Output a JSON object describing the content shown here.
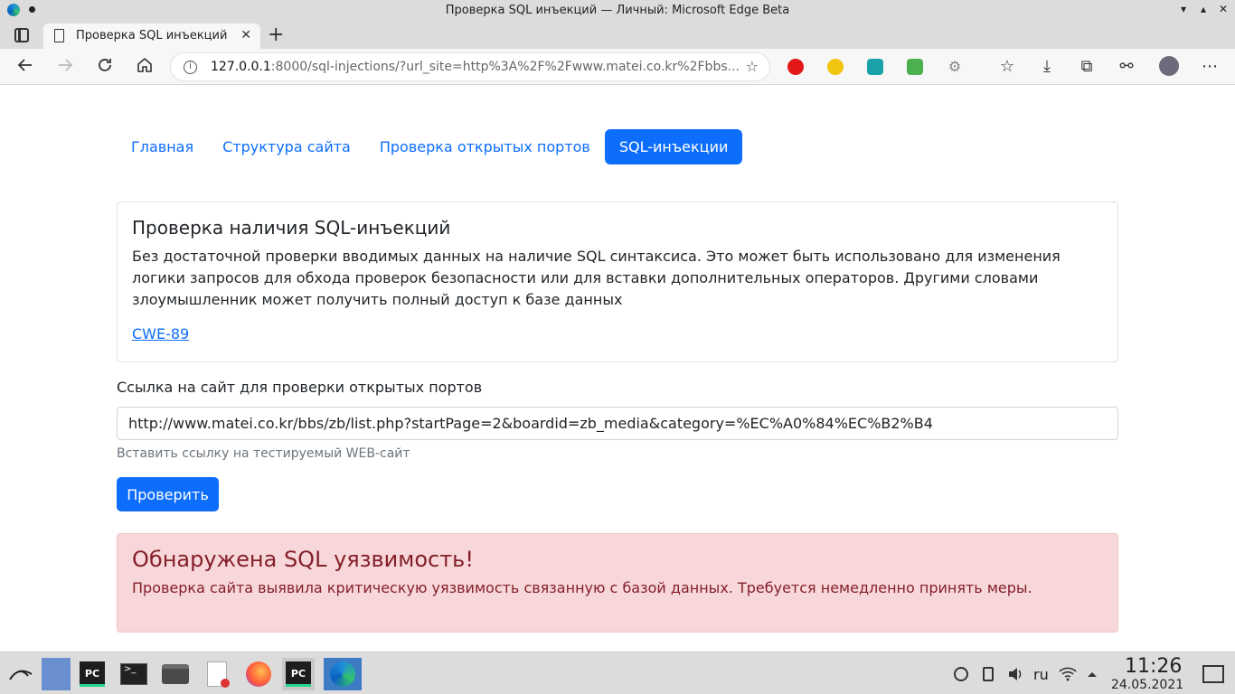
{
  "window": {
    "title": "Проверка SQL инъекций — Личный: Microsoft Edge Beta",
    "minimize": "▾",
    "maximize": "▴",
    "close": "✕"
  },
  "tab": {
    "title": "Проверка SQL инъекций",
    "close": "✕",
    "new_tab": "+"
  },
  "address_bar": {
    "url_host": "127.0.0.1",
    "url_rest": ":8000/sql-injections/?url_site=http%3A%2F%2Fwww.matei.co.kr%2Fbbs..."
  },
  "nav": {
    "items": [
      {
        "label": "Главная",
        "active": false
      },
      {
        "label": "Структура сайта",
        "active": false
      },
      {
        "label": "Проверка открытых портов",
        "active": false
      },
      {
        "label": "SQL-инъекции",
        "active": true
      }
    ]
  },
  "card": {
    "title": "Проверка наличия SQL-инъекций",
    "text": "Без достаточной проверки вводимых данных на наличие SQL синтаксиса. Это может быть использовано для изменения логики запросов для обхода проверок безопасности или для вставки дополнительных операторов. Другими словами злоумышленник может получить полный доступ к базе данных",
    "link": "CWE-89"
  },
  "form": {
    "label": "Ссылка на сайт для проверки открытых портов",
    "value": "http://www.matei.co.kr/bbs/zb/list.php?startPage=2&boardid=zb_media&category=%EC%A0%84%EC%B2%B4",
    "help": "Вставить ссылку на тестируемый WEB-сайт",
    "submit": "Проверить"
  },
  "alert": {
    "title": "Обнаружена SQL уязвимость!",
    "text": "Проверка сайта выявила критическую уязвимость связанную с базой данных. Требуется немедленно принять меры."
  },
  "taskbar": {
    "language": "ru",
    "time": "11:26",
    "date": "24.05.2021"
  },
  "colors": {
    "primary": "#0d6efd",
    "alert_bg": "#f8d7da",
    "alert_text": "#842029"
  }
}
